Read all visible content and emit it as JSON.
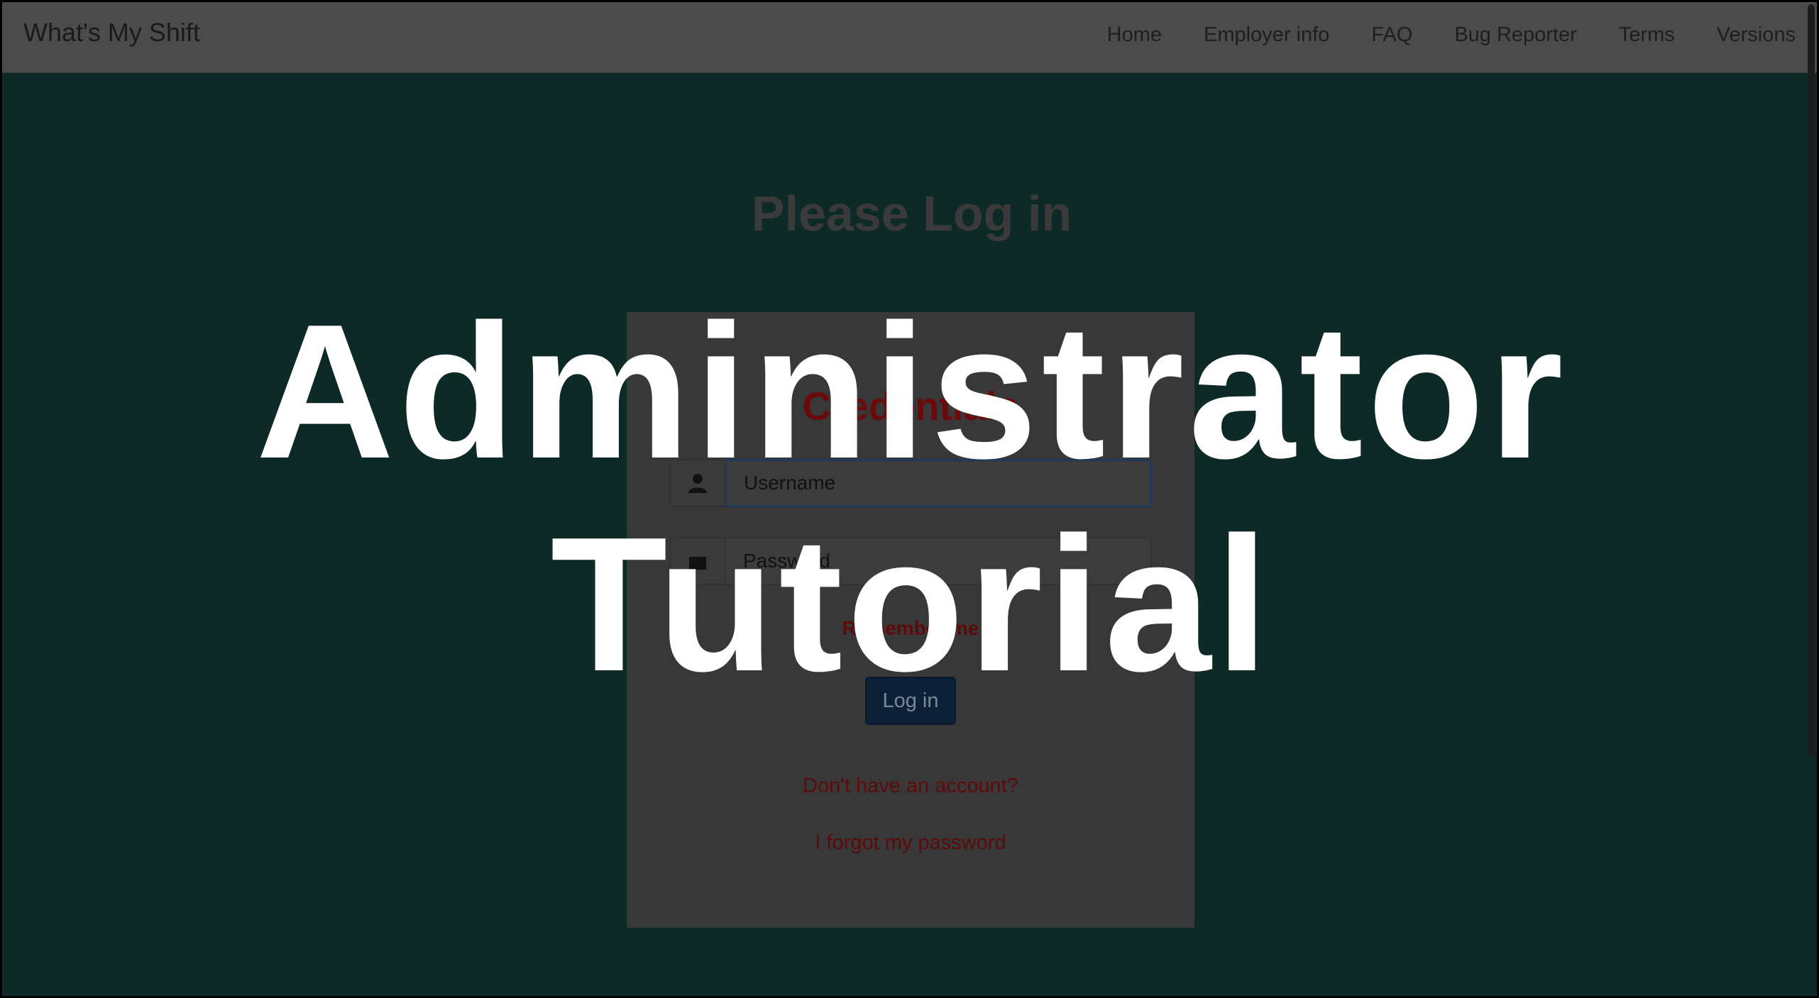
{
  "navbar": {
    "brand": "What's My Shift",
    "links": [
      "Home",
      "Employer info",
      "FAQ",
      "Bug Reporter",
      "Terms",
      "Versions"
    ]
  },
  "page": {
    "title": "Please Log in"
  },
  "login_panel": {
    "title": "Credentials",
    "username_placeholder": "Username",
    "password_placeholder": "Password",
    "remember_label": "Remember me",
    "login_button": "Log in",
    "signup_link": "Don't have an account?",
    "forgot_link": "I forgot my password"
  },
  "overlay": {
    "line1": "Administrator",
    "line2": "Tutorial"
  },
  "icons": {
    "username": "user-icon",
    "password": "lock-icon"
  },
  "colors": {
    "background": "#0e2a27",
    "navbar": "#4b4b4b",
    "panel": "#383838",
    "link_red": "#5e0a0a",
    "button": "#0c2138",
    "overlay_text": "#ffffff"
  }
}
